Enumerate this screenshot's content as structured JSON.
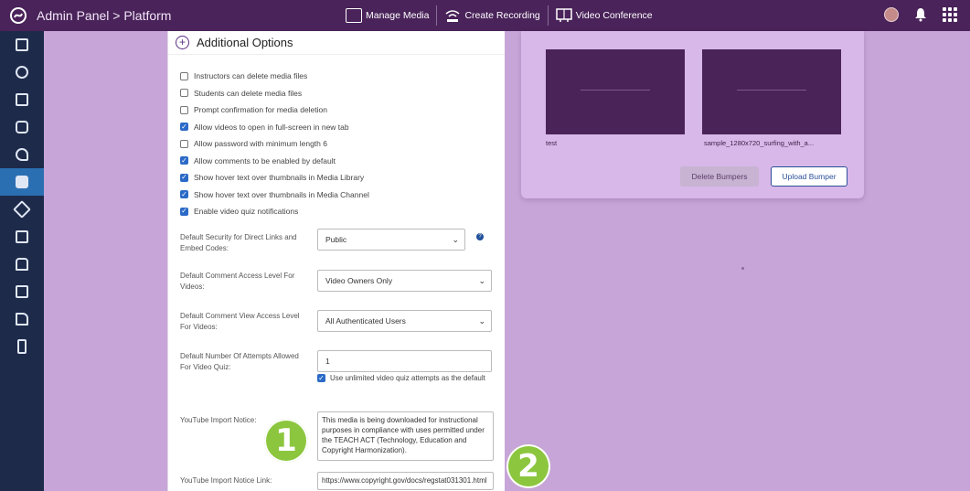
{
  "header": {
    "breadcrumb": "Admin Panel > Platform",
    "toolbar": [
      {
        "label": "Manage Media",
        "icon": "folder-icon"
      },
      {
        "label": "Create Recording",
        "icon": "wifi-icon"
      },
      {
        "label": "Video Conference",
        "icon": "conference-icon"
      }
    ]
  },
  "sidebar": {
    "items": [
      {
        "icon": "grid-icon"
      },
      {
        "icon": "search-icon"
      },
      {
        "icon": "monitor-icon"
      },
      {
        "icon": "people-icon"
      },
      {
        "icon": "key-icon"
      },
      {
        "icon": "media-icon",
        "active": true
      },
      {
        "icon": "paint-icon"
      },
      {
        "icon": "captions-icon"
      },
      {
        "icon": "storage-icon"
      },
      {
        "icon": "archive-icon"
      },
      {
        "icon": "device-icon"
      },
      {
        "icon": "building-icon"
      }
    ]
  },
  "options": {
    "title": "Additional Options",
    "checkboxes": [
      {
        "label": "Instructors can delete media files",
        "checked": false
      },
      {
        "label": "Students can delete media files",
        "checked": false
      },
      {
        "label": "Prompt confirmation for media deletion",
        "checked": false
      },
      {
        "label": "Allow videos to open in full-screen in new tab",
        "checked": true
      },
      {
        "label": "Allow password with minimum length 6",
        "checked": false
      },
      {
        "label": "Allow comments to be enabled by default",
        "checked": true
      },
      {
        "label": "Show hover text over thumbnails in Media Library",
        "checked": true
      },
      {
        "label": "Show hover text over thumbnails in Media Channel",
        "checked": true
      },
      {
        "label": "Enable video quiz notifications",
        "checked": true
      }
    ],
    "security_label": "Default Security for Direct Links and Embed Codes:",
    "security_value": "Public",
    "comment_access_label": "Default Comment Access Level For Videos:",
    "comment_access_value": "Video Owners Only",
    "comment_view_label": "Default Comment View Access Level For Videos:",
    "comment_view_value": "All Authenticated Users",
    "attempts_label": "Default Number Of Attempts Allowed For Video Quiz:",
    "attempts_value": "1",
    "unlimited_label": "Use unlimited video quiz attempts as the default",
    "youtube_notice_label": "YouTube Import Notice:",
    "youtube_notice_value": "This media is being downloaded for instructional purposes in compliance with uses permitted under the TEACH ACT (Technology, Education and Copyright Harmonization).",
    "youtube_link_label": "YouTube Import Notice Link:",
    "youtube_link_value": "https://www.copyright.gov/docs/regstat031301.html"
  },
  "bumpers": {
    "items": [
      {
        "name": "test"
      },
      {
        "name": "sample_1280x720_surfing_with_a..."
      }
    ],
    "delete_label": "Delete Bumpers",
    "upload_label": "Upload Bumper"
  },
  "badges": [
    "1",
    "2"
  ],
  "colors": {
    "topbar": "#4a235a",
    "sidebar": "#1e2a4a",
    "canvas": "#c7a5d8",
    "badge": "#8cc63f",
    "check": "#2c6ac7"
  }
}
